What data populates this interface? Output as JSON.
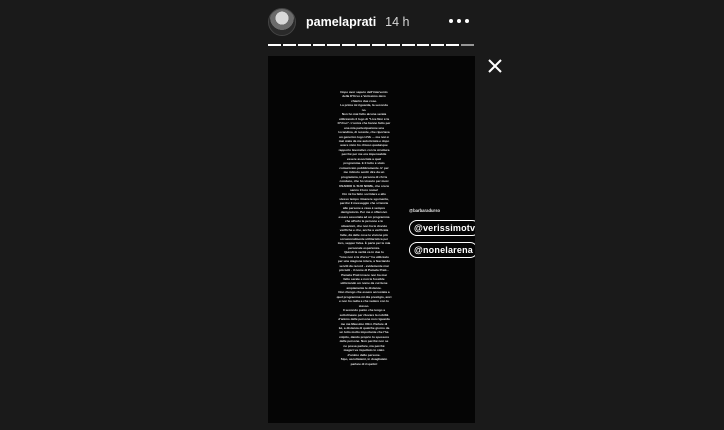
{
  "header": {
    "username": "pamelaprati",
    "timestamp": "14 h",
    "avatar_icon": "profile-avatar",
    "more_icon": "more-horizontal-icon",
    "close_icon": "close-icon"
  },
  "progress": {
    "total": 14,
    "completed": 13
  },
  "story": {
    "body_text": "Dopo aver saputo dell'intervento\ndella D'Urso e Verissimo devo\nchiarire due cose.\nLa prima mi riguarda, la seconda\nno.\nNon ho mai fatto alcuna serata\nutilizzando il logo di \"Live Non è la\nD'Urso\". L'unica che hanno fatto per\nuna mia partecipazione una\nlocandina, di recente, che riportava\nun generico logo LIVE ... ma non è\nmai stata da me autorizzata e dopo\navere visto ho chiuso qualunque\nrapporto lavorativo con la struttura\nperché per me era impensabile\nessere associata a quel\nprogramma. E il tutto è stato\ncomunicato pubblicamente. E' per\nme ridicolo sentir dire da un\nprogramma, in persona di chi la\nconduce, che ho vissuto per mesi\nUSANDO IL SUO NOME, che ora le\nsanno il loro nome!\nCiò mi ha fatto sorridere e allo\nstesso tempo rimanere sgomenta,\nperché il messaggio che si lancia\nalle persone a casa è sempre\ndenigratorio. Per me è offensivo\nessere associata ad un programma\nche all'urlo le persone e le\nsituazioni, che non ha le dovute\nverifiche e che, anche a verificata\nfatte, dà delle cose le visione più\noccasionalmente utilitaristica per\nloro, seppur falsa. È parte per le mia\npersonale esperienza.\nQuindi la verità va in due lo\n\"Live non è la d'urso\" ha utilizzato\nper una stagione intera, a fasciando\nservitì da record - evidemente mai\npiù tutti - il nome di Pamela Prati...\nPamela Prati invece non ha mai\nfatto serate e non le fossible\nutilizzando un nome da cui tiene\nampiamente le distanze.\nNon ritengo che essere accostata a\nquel programma mi dia prestigio, anzi\ne non ho nulla a che vedere con lo\nstesso.\nIl secondo punto che tengo a\nsottolineare per rilevare la nobiltà\nd'animo delle persone non riguarda\nme ma Massimo Olivi. Parlare di\nlui, a distanza di qualche giorno da\nun lutto molto importante che l'ha\ncolpito, dando proprio lo spessore\ndelle persone. Non perché non se\nne possa parlare, ma perché\nmagari va rispettato lo stato\nd'animo delle persone.\nSipo, ascoltatemi, in doagliatelo\nparlare di rispetto!",
    "tags": {
      "small": "@barbaradurso",
      "mention_1": "@verissimotv",
      "mention_2": "@nonelarena"
    }
  }
}
